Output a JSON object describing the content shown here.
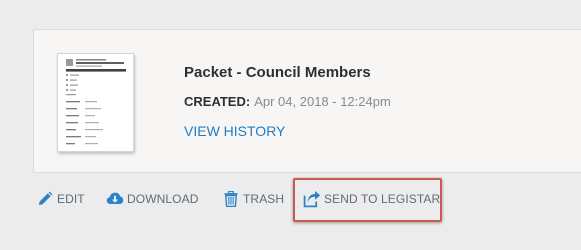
{
  "document": {
    "title": "Packet - Council Members",
    "created_label": "CREATED:",
    "created_value": "Apr 04, 2018 - 12:24pm",
    "view_history_label": "VIEW HISTORY",
    "thumbnail_icon": "document-thumbnail"
  },
  "actions": {
    "edit": {
      "label": "EDIT",
      "icon": "pencil-icon"
    },
    "download": {
      "label": "DOWNLOAD",
      "icon": "cloud-download-icon"
    },
    "trash": {
      "label": "TRASH",
      "icon": "trash-icon"
    },
    "send": {
      "label": "SEND TO LEGISTAR",
      "icon": "share-icon"
    }
  },
  "colors": {
    "link": "#1e7dc6",
    "action_text": "#5d6c7a",
    "action_icon": "#2a82c9",
    "highlight_border": "#c9584f"
  }
}
